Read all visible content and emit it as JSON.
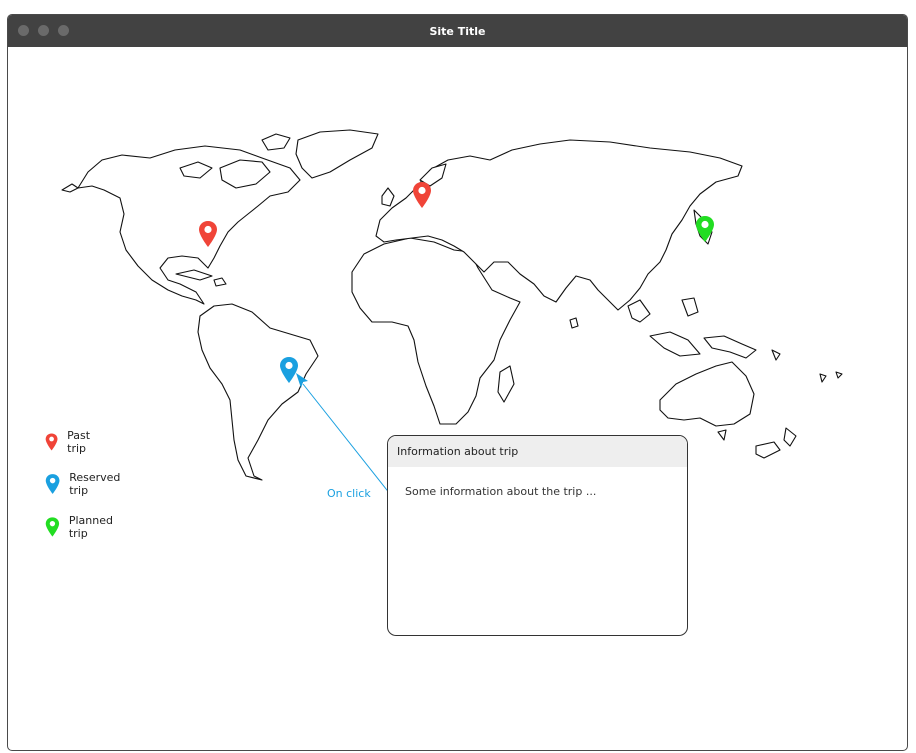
{
  "window": {
    "title": "Site Title"
  },
  "map": {
    "pins": [
      {
        "name": "pin-north-america",
        "type": "past",
        "color": "#f04438"
      },
      {
        "name": "pin-europe",
        "type": "past",
        "color": "#f04438"
      },
      {
        "name": "pin-japan",
        "type": "planned",
        "color": "#22dd22"
      },
      {
        "name": "pin-brazil",
        "type": "reserved",
        "color": "#1aa0e0"
      }
    ]
  },
  "legend": {
    "items": [
      {
        "label": "Past trip",
        "color": "#f04438",
        "icon": "map-pin-icon"
      },
      {
        "label": "Reserved trip",
        "color": "#1aa0e0",
        "icon": "map-pin-icon"
      },
      {
        "label": "Planned trip",
        "color": "#22dd22",
        "icon": "map-pin-icon"
      }
    ]
  },
  "annotation": {
    "on_click_label": "On click",
    "color": "#1aa0e0"
  },
  "info_panel": {
    "header": "Information about trip",
    "body": "Some information about the trip ..."
  }
}
